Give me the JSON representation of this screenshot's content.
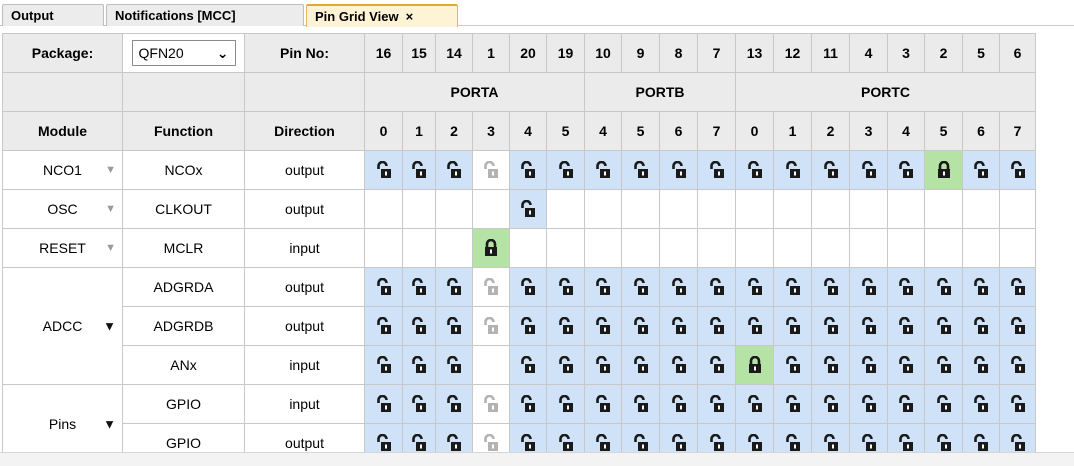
{
  "tabs": [
    {
      "label": "Output"
    },
    {
      "label": "Notifications [MCC]"
    },
    {
      "label": "Pin Grid View",
      "close": "×"
    }
  ],
  "header": {
    "package_label": "Package:",
    "package_value": "QFN20",
    "pin_no_label": "Pin No:",
    "pin_numbers": [
      "16",
      "15",
      "14",
      "1",
      "20",
      "19",
      "10",
      "9",
      "8",
      "7",
      "13",
      "12",
      "11",
      "4",
      "3",
      "2",
      "5",
      "6"
    ],
    "ports": [
      {
        "name": "PORTA",
        "span": 6
      },
      {
        "name": "PORTB",
        "span": 4
      },
      {
        "name": "PORTC",
        "span": 8
      }
    ],
    "module_label": "Module",
    "function_label": "Function",
    "direction_label": "Direction",
    "bit_numbers": [
      "0",
      "1",
      "2",
      "3",
      "4",
      "5",
      "4",
      "5",
      "6",
      "7",
      "0",
      "1",
      "2",
      "3",
      "4",
      "5",
      "6",
      "7"
    ]
  },
  "colors": {
    "available": "#cfe2f7",
    "selected": "#b5e3a6",
    "header_bg": "#ebebeb",
    "border": "#c8c8c8"
  },
  "rows": [
    {
      "module": "NCO1",
      "module_arrow": "light",
      "function": "NCOx",
      "direction": "output",
      "cells": [
        "u",
        "u",
        "u",
        "g",
        "u",
        "u",
        "u",
        "u",
        "u",
        "u",
        "u",
        "u",
        "u",
        "u",
        "u",
        "L",
        "u",
        "u"
      ]
    },
    {
      "module": "OSC",
      "module_arrow": "light",
      "function": "CLKOUT",
      "direction": "output",
      "cells": [
        "",
        "",
        "",
        "",
        "u",
        "",
        "",
        "",
        "",
        "",
        "",
        "",
        "",
        "",
        "",
        "",
        "",
        ""
      ]
    },
    {
      "module": "RESET",
      "module_arrow": "light",
      "function": "MCLR",
      "direction": "input",
      "cells": [
        "",
        "",
        "",
        "L",
        "",
        "",
        "",
        "",
        "",
        "",
        "",
        "",
        "",
        "",
        "",
        "",
        "",
        ""
      ]
    },
    {
      "module": "ADCC",
      "module_arrow": "dark",
      "module_rowspan": 3,
      "function": "ADGRDA",
      "direction": "output",
      "cells": [
        "u",
        "u",
        "u",
        "g",
        "u",
        "u",
        "u",
        "u",
        "u",
        "u",
        "u",
        "u",
        "u",
        "u",
        "u",
        "u",
        "u",
        "u"
      ]
    },
    {
      "module": null,
      "function": "ADGRDB",
      "direction": "output",
      "cells": [
        "u",
        "u",
        "u",
        "g",
        "u",
        "u",
        "u",
        "u",
        "u",
        "u",
        "u",
        "u",
        "u",
        "u",
        "u",
        "u",
        "u",
        "u"
      ]
    },
    {
      "module": null,
      "function": "ANx",
      "direction": "input",
      "cells": [
        "u",
        "u",
        "u",
        "",
        "u",
        "u",
        "u",
        "u",
        "u",
        "u",
        "L",
        "u",
        "u",
        "u",
        "u",
        "u",
        "u",
        "u"
      ]
    },
    {
      "module": "Pins",
      "module_arrow": "dark",
      "module_rowspan": 2,
      "function": "GPIO",
      "direction": "input",
      "cells": [
        "u",
        "u",
        "u",
        "g",
        "u",
        "u",
        "u",
        "u",
        "u",
        "u",
        "u",
        "u",
        "u",
        "u",
        "u",
        "u",
        "u",
        "u"
      ]
    },
    {
      "module": null,
      "function": "GPIO",
      "direction": "output",
      "cells": [
        "u",
        "u",
        "u",
        "g",
        "u",
        "u",
        "u",
        "u",
        "u",
        "u",
        "u",
        "u",
        "u",
        "u",
        "u",
        "u",
        "u",
        "u"
      ]
    }
  ],
  "icons": {
    "u": "unlock-icon",
    "g": "unlock-disabled-icon",
    "L": "lock-icon",
    "dropdown": "chevron-down-icon"
  }
}
